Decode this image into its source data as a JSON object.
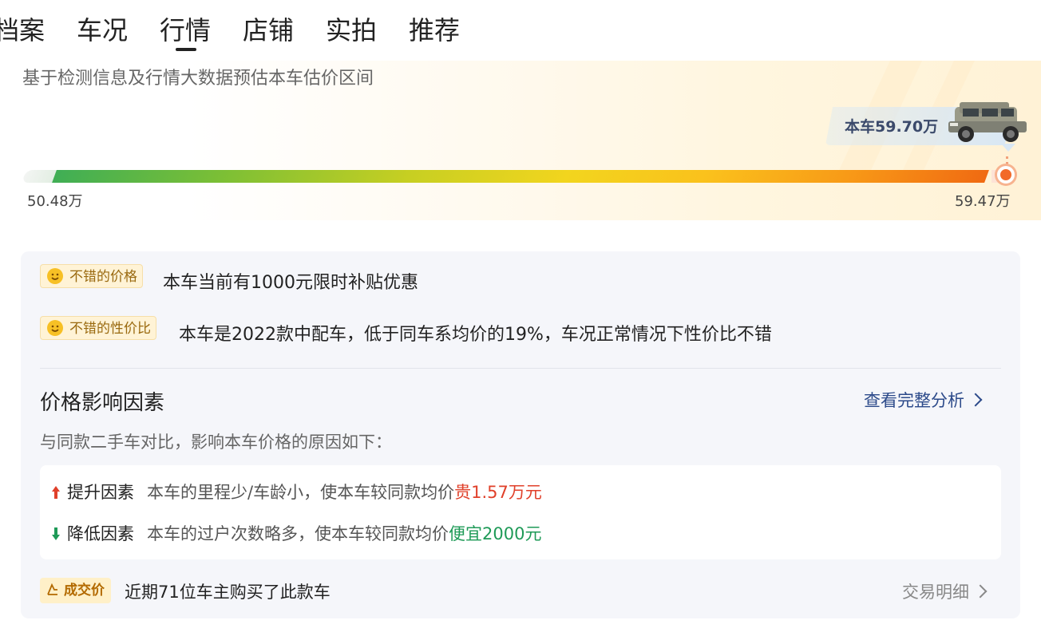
{
  "tabs": [
    {
      "label": "档案"
    },
    {
      "label": "车况"
    },
    {
      "label": "行情",
      "active": true
    },
    {
      "label": "店铺"
    },
    {
      "label": "实拍"
    },
    {
      "label": "推荐"
    }
  ],
  "price_band": {
    "subtitle": "基于检测信息及行情大数据预估本车估价区间",
    "min_label": "50.48万",
    "max_label": "59.47万",
    "this_car_label": "本车59.70万"
  },
  "highlights": [
    {
      "tag": "不错的价格",
      "text": "本车当前有1000元限时补贴优惠",
      "icon": "smile-icon"
    },
    {
      "tag": "不错的性价比",
      "text": "本车是2022款中配车，低于同车系均价的19%，车况正常情况下性价比不错",
      "icon": "smile-icon"
    }
  ],
  "factors": {
    "title": "价格影响因素",
    "link": "查看完整分析",
    "subtitle": "与同款二手车对比，影响本车价格的原因如下：",
    "items": [
      {
        "direction": "up",
        "label": "提升因素",
        "desc": "本车的里程少/车龄小，使本车较同款均价",
        "highlight": "贵1.57万元",
        "color": "#e0402a"
      },
      {
        "direction": "down",
        "label": "降低因素",
        "desc": "本车的过户次数略多，使本车较同款均价",
        "highlight": "便宜2000元",
        "color": "#1e9a57"
      }
    ]
  },
  "deal": {
    "tag": "成交价",
    "text": "近期71位车主购买了此款车",
    "link": "交易明细"
  }
}
